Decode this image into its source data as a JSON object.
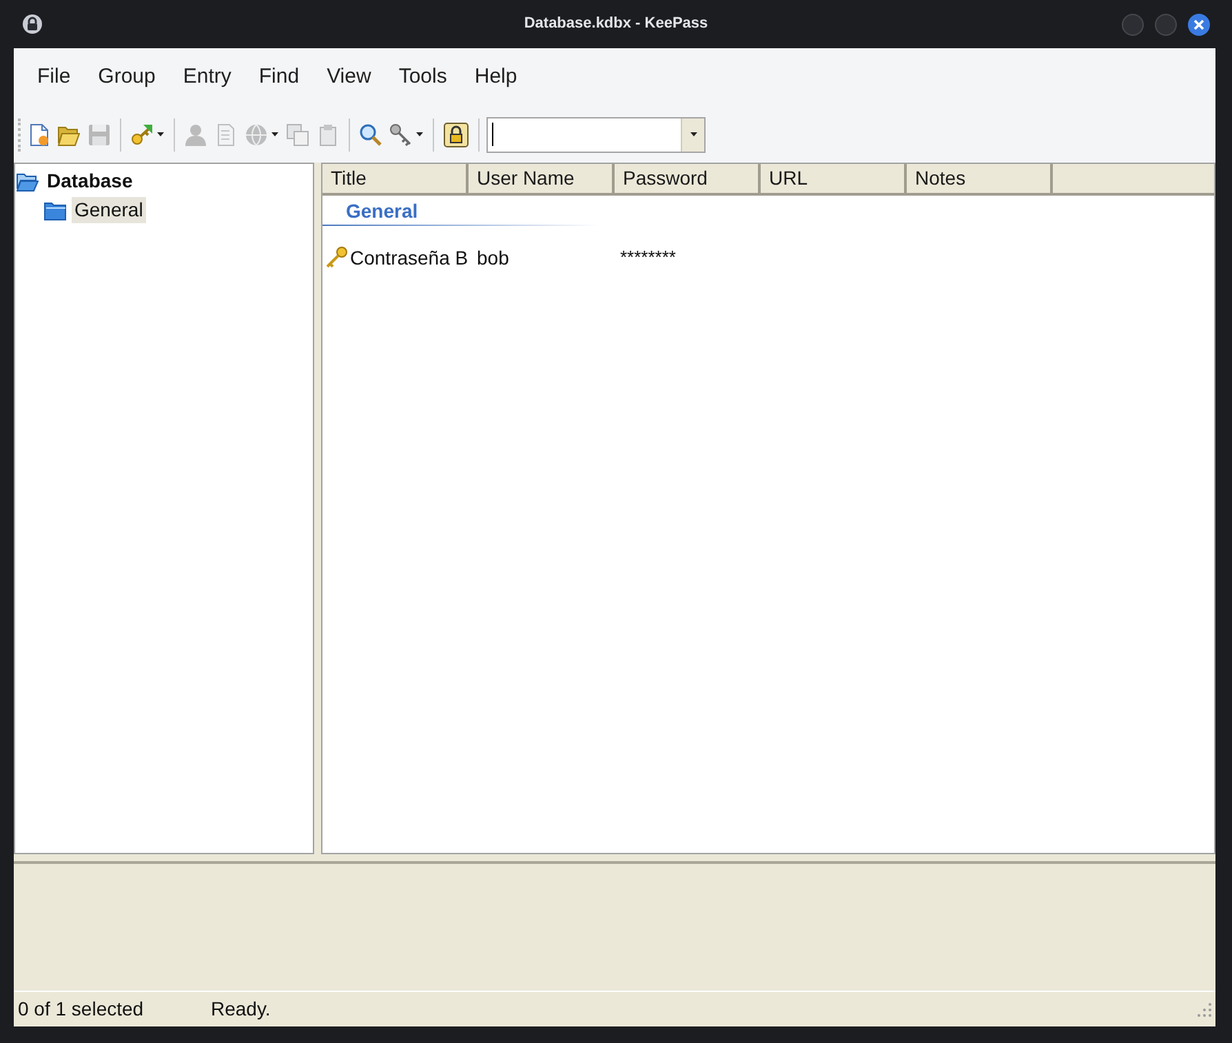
{
  "window": {
    "title": "Database.kdbx - KeePass"
  },
  "menu": [
    "File",
    "Group",
    "Entry",
    "Find",
    "View",
    "Tools",
    "Help"
  ],
  "toolbar": [
    {
      "kind": "button",
      "disabled": false
    },
    {
      "kind": "button",
      "disabled": false
    },
    {
      "kind": "button",
      "disabled": true
    },
    {
      "kind": "separator"
    },
    {
      "kind": "button",
      "disabled": false,
      "dropdown": true
    },
    {
      "kind": "separator"
    },
    {
      "kind": "button",
      "disabled": true
    },
    {
      "kind": "button",
      "disabled": true
    },
    {
      "kind": "button",
      "disabled": true,
      "dropdown": true
    },
    {
      "kind": "button",
      "disabled": true
    },
    {
      "kind": "button",
      "disabled": true
    },
    {
      "kind": "separator"
    },
    {
      "kind": "button",
      "disabled": false
    },
    {
      "kind": "button",
      "disabled": false,
      "dropdown": true
    },
    {
      "kind": "separator"
    },
    {
      "kind": "button",
      "disabled": false
    },
    {
      "kind": "separator"
    },
    {
      "kind": "search"
    }
  ],
  "tree": [
    {
      "label": "Database",
      "expanded": true,
      "selected": false,
      "children": [
        {
          "label": "General",
          "selected": true
        }
      ]
    }
  ],
  "entry_list": {
    "columns": [
      "Title",
      "User Name",
      "Password",
      "URL",
      "Notes"
    ],
    "groups": [
      {
        "name": "General",
        "entries": [
          {
            "title": "Contraseña B",
            "user_name": "bob",
            "password": "********",
            "selected": false
          }
        ]
      }
    ]
  },
  "status_bar": {
    "selection": "0 of 1 selected",
    "message": "Ready."
  }
}
